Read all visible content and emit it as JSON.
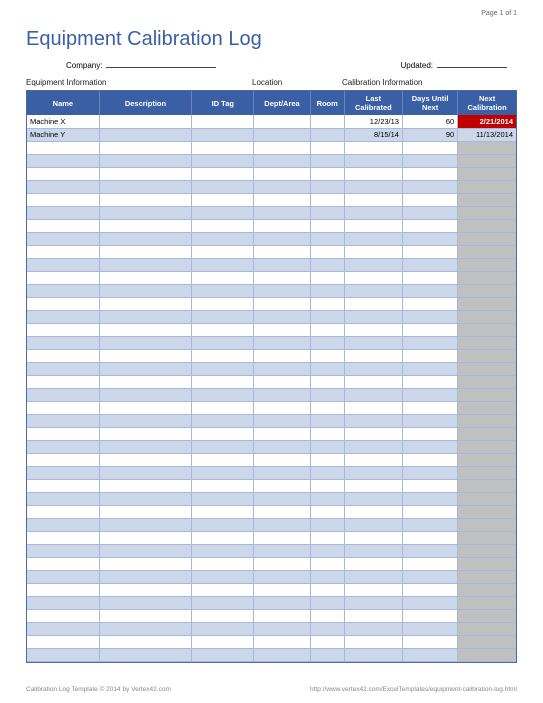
{
  "page_number": "Page 1 of 1",
  "title": "Equipment Calibration Log",
  "info": {
    "company_label": "Company:",
    "updated_label": "Updated:"
  },
  "sections": {
    "equipment": "Equipment Information",
    "location": "Location",
    "calibration": "Calibration Information"
  },
  "columns": {
    "name": "Name",
    "description": "Description",
    "idtag": "ID Tag",
    "dept": "Dept/Area",
    "room": "Room",
    "last": "Last Calibrated",
    "days": "Days Until Next",
    "next": "Next Calibration"
  },
  "rows": [
    {
      "name": "Machine X",
      "desc": "",
      "tag": "",
      "dept": "",
      "room": "",
      "last": "12/23/13",
      "days": "60",
      "next": "2/21/2014",
      "overdue": true
    },
    {
      "name": "Machine Y",
      "desc": "",
      "tag": "",
      "dept": "",
      "room": "",
      "last": "8/15/14",
      "days": "90",
      "next": "11/13/2014",
      "overdue": false
    }
  ],
  "empty_row_count": 40,
  "footer": {
    "left": "Calibration Log Template © 2014 by Vertex42.com",
    "right": "http://www.vertex42.com/ExcelTemplates/equipment-calibration-log.html"
  }
}
